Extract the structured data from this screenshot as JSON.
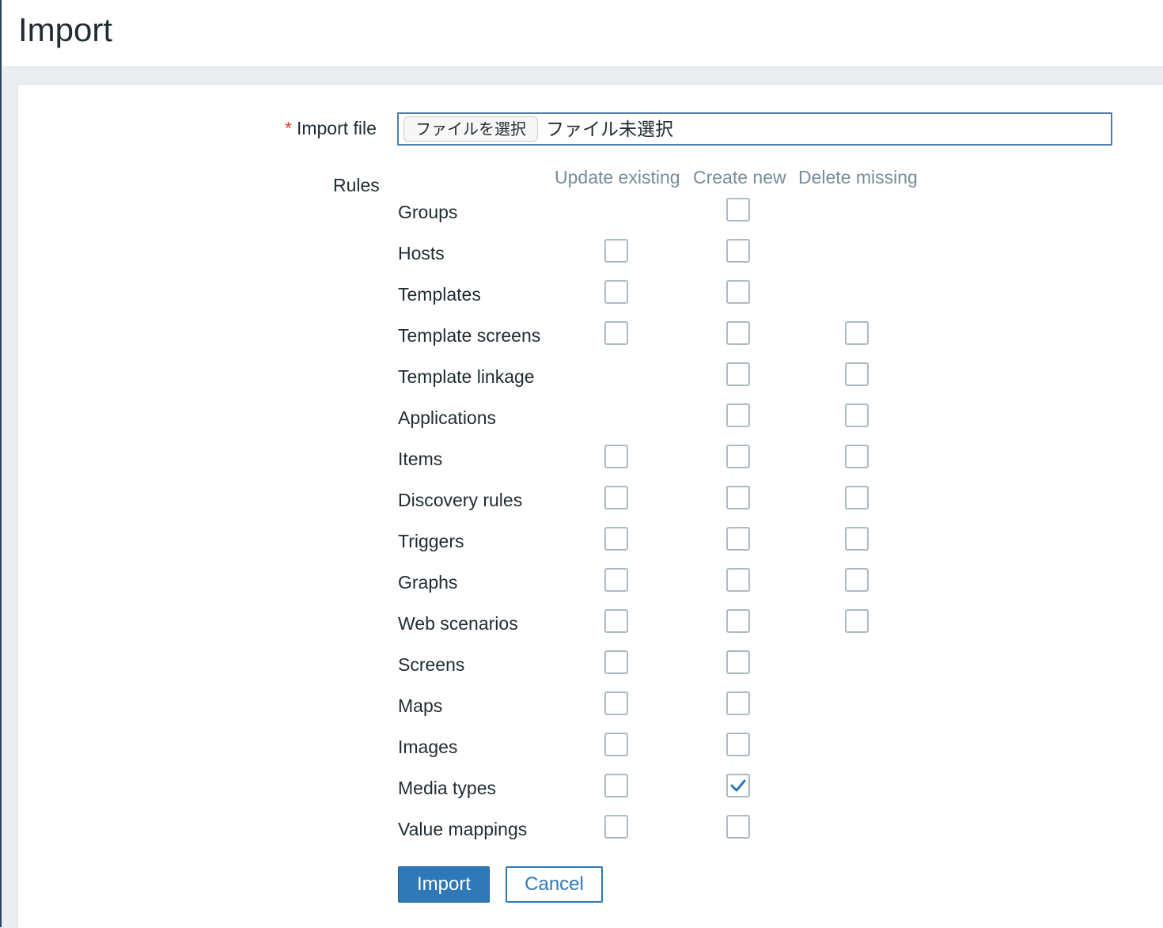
{
  "page": {
    "title": "Import"
  },
  "form": {
    "file_label": "Import file",
    "required_marker": "*",
    "file_button_label": "ファイルを選択",
    "file_status": "ファイル未選択",
    "rules_label": "Rules"
  },
  "columns": {
    "update": "Update existing",
    "create": "Create new",
    "delete": "Delete missing"
  },
  "rules": [
    {
      "label": "Groups",
      "update": null,
      "create": false,
      "delete": null
    },
    {
      "label": "Hosts",
      "update": false,
      "create": false,
      "delete": null
    },
    {
      "label": "Templates",
      "update": false,
      "create": false,
      "delete": null
    },
    {
      "label": "Template screens",
      "update": false,
      "create": false,
      "delete": false
    },
    {
      "label": "Template linkage",
      "update": null,
      "create": false,
      "delete": false
    },
    {
      "label": "Applications",
      "update": null,
      "create": false,
      "delete": false
    },
    {
      "label": "Items",
      "update": false,
      "create": false,
      "delete": false
    },
    {
      "label": "Discovery rules",
      "update": false,
      "create": false,
      "delete": false
    },
    {
      "label": "Triggers",
      "update": false,
      "create": false,
      "delete": false
    },
    {
      "label": "Graphs",
      "update": false,
      "create": false,
      "delete": false
    },
    {
      "label": "Web scenarios",
      "update": false,
      "create": false,
      "delete": false
    },
    {
      "label": "Screens",
      "update": false,
      "create": false,
      "delete": null
    },
    {
      "label": "Maps",
      "update": false,
      "create": false,
      "delete": null
    },
    {
      "label": "Images",
      "update": false,
      "create": false,
      "delete": null
    },
    {
      "label": "Media types",
      "update": false,
      "create": true,
      "delete": null
    },
    {
      "label": "Value mappings",
      "update": false,
      "create": false,
      "delete": null
    }
  ],
  "buttons": {
    "import": "Import",
    "cancel": "Cancel"
  },
  "colors": {
    "accent": "#2f78b7",
    "column_header": "#768d99",
    "required": "#e33734"
  }
}
